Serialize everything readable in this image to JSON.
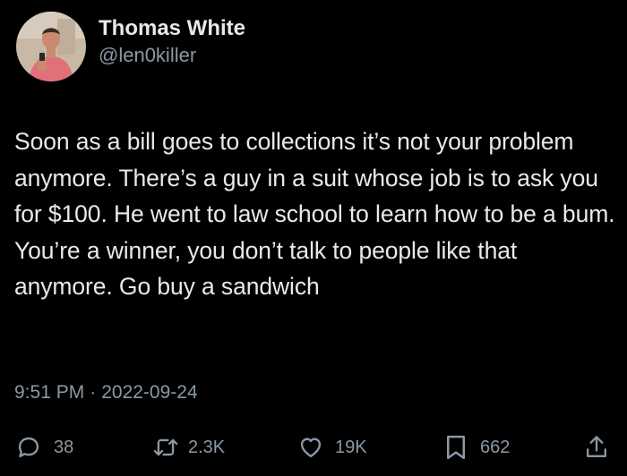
{
  "author": {
    "display_name": "Thomas White",
    "handle": "@len0killer"
  },
  "tweet": {
    "text": "Soon as a bill goes to collections it’s not your problem anymore. There’s a guy in a suit whose job is to ask you for $100. He went to law school to learn how to be a bum. You’re a winner, you don’t talk to people like that anymore. Go buy a sandwich",
    "time": "9:51 PM",
    "separator": "·",
    "date": "2022-09-24"
  },
  "actions": {
    "replies": "38",
    "retweets": "2.3K",
    "likes": "19K",
    "bookmarks": "662"
  },
  "icons": {
    "reply": "reply-icon",
    "retweet": "retweet-icon",
    "like": "heart-icon",
    "bookmark": "bookmark-icon",
    "share": "share-icon"
  },
  "colors": {
    "background": "#000000",
    "text": "#e7e9ea",
    "secondary": "#8b98a5"
  }
}
